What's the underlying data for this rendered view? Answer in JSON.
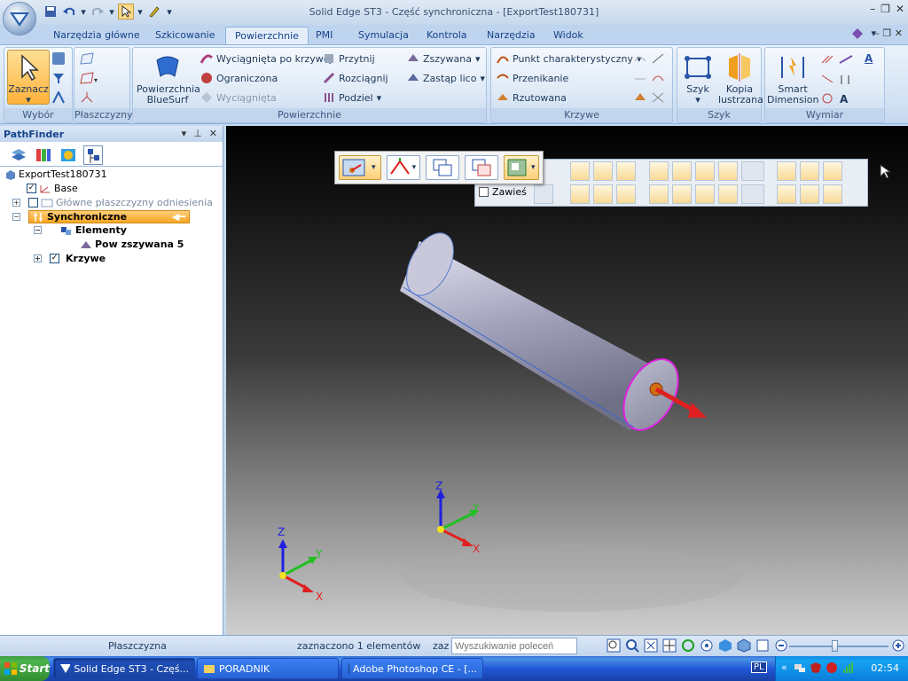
{
  "window": {
    "title": "Solid Edge ST3 - Część synchroniczna - [ExportTest180731]"
  },
  "tabs": [
    {
      "label": "Narzędzia główne"
    },
    {
      "label": "Szkicowanie"
    },
    {
      "label": "Powierzchnie"
    },
    {
      "label": "PMI"
    },
    {
      "label": "Symulacja"
    },
    {
      "label": "Kontrola"
    },
    {
      "label": "Narzędzia"
    },
    {
      "label": "Widok"
    }
  ],
  "ribbon": {
    "groups": {
      "wybor": "Wybór",
      "plaszczyzny": "Płaszczyzny",
      "powierzchnie": "Powierzchnie",
      "krzywe": "Krzywe",
      "szyk": "Szyk",
      "wymiar": "Wymiar"
    },
    "zaznacz": "Zaznacz",
    "bluesurf_1": "Powierzchnia",
    "bluesurf_2": "BlueSurf",
    "wyciagnieta_po_krzywej": "Wyciągnięta po krzywej",
    "ograniczona": "Ograniczona",
    "wyciagnieta": "Wyciągnięta",
    "przytnij": "Przytnij",
    "rozciagnij": "Rozciągnij",
    "podziel": "Podziel",
    "zszywana": "Zszywana",
    "zastap_lico": "Zastąp lico",
    "punkt_char": "Punkt charakterystyczny",
    "przenikanie": "Przenikanie",
    "rzutowana": "Rzutowana",
    "szyk": "Szyk",
    "kopia_1": "Kopia",
    "kopia_2": "lustrzana",
    "smart_1": "Smart",
    "smart_2": "Dimension"
  },
  "pathfinder": {
    "title": "PathFinder",
    "tree": {
      "root": "ExportTest180731",
      "base": "Base",
      "planes": "Główne płaszczyzny odniesienia",
      "sync": "Synchroniczne",
      "elements": "Elementy",
      "pow": "Pow zszywana 5",
      "curves": "Krzywe"
    }
  },
  "command_bar": {
    "zawies": "Zawieś"
  },
  "axes": {
    "x": "X",
    "y": "Y",
    "z": "Z"
  },
  "status": {
    "left": "Płaszczyzna",
    "middle": "zaznaczono 1 elementów",
    "prefix": "zaz",
    "search_placeholder": "Wyszukiwanie poleceń"
  },
  "taskbar": {
    "start": "Start",
    "tasks": [
      {
        "label": "Solid Edge ST3 - Częś..."
      },
      {
        "label": "PORADNIK"
      },
      {
        "label": "Adobe Photoshop CE - [..."
      }
    ],
    "lang": "PL",
    "time": "02:54"
  },
  "colors": {
    "accent_orange": "#f5a623",
    "selection_magenta": "#e020e0",
    "axis_red": "#e02020",
    "axis_green": "#20c020",
    "axis_blue": "#2020e0"
  }
}
